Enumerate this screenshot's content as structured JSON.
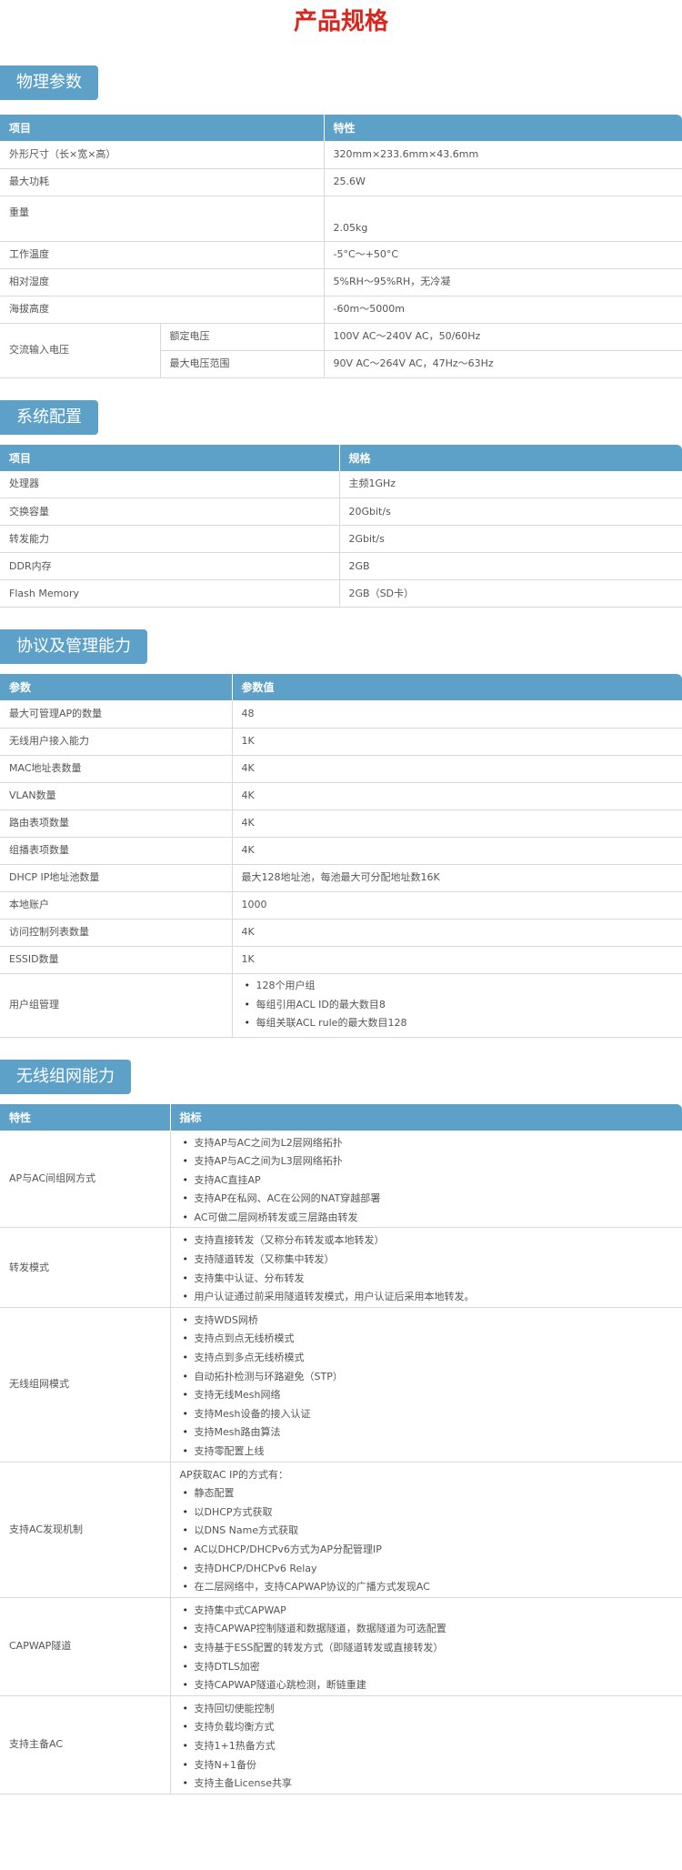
{
  "page_title": "产品规格",
  "physical": {
    "header": "物理参数",
    "col1": "项目",
    "col2": "特性",
    "rows": [
      {
        "label": "外形尺寸（长×宽×高）",
        "value": "320mm×233.6mm×43.6mm"
      },
      {
        "label": "最大功耗",
        "value": "25.6W"
      },
      {
        "label": "重量",
        "value": "2.05kg"
      },
      {
        "label": "工作温度",
        "value": "-5°C～+50°C"
      },
      {
        "label": "相对湿度",
        "value": "5%RH～95%RH，无冷凝"
      },
      {
        "label": "海拔高度",
        "value": "-60m～5000m"
      }
    ],
    "ac": {
      "label": "交流输入电压",
      "rated_label": "额定电压",
      "rated_value": "100V AC～240V AC，50/60Hz",
      "max_label": "最大电压范围",
      "max_value": "90V AC～264V AC，47Hz～63Hz"
    }
  },
  "system": {
    "header": "系统配置",
    "col1": "项目",
    "col2": "规格",
    "rows": [
      {
        "label": "处理器",
        "value": "主频1GHz"
      },
      {
        "label": "交换容量",
        "value": "20Gbit/s"
      },
      {
        "label": "转发能力",
        "value": "2Gbit/s"
      },
      {
        "label": "DDR内存",
        "value": "2GB"
      },
      {
        "label": "Flash Memory",
        "value": "2GB（SD卡）"
      }
    ]
  },
  "protocol": {
    "header": "协议及管理能力",
    "col1": "参数",
    "col2": "参数值",
    "rows": [
      {
        "label": "最大可管理AP的数量",
        "value": "48"
      },
      {
        "label": "无线用户接入能力",
        "value": "1K"
      },
      {
        "label": "MAC地址表数量",
        "value": "4K"
      },
      {
        "label": "VLAN数量",
        "value": "4K"
      },
      {
        "label": "路由表项数量",
        "value": "4K"
      },
      {
        "label": "组播表项数量",
        "value": "4K"
      },
      {
        "label": "DHCP IP地址池数量",
        "value": "最大128地址池，每池最大可分配地址数16K"
      },
      {
        "label": "本地账户",
        "value": "1000"
      },
      {
        "label": "访问控制列表数量",
        "value": "4K"
      },
      {
        "label": "ESSID数量",
        "value": "1K"
      }
    ],
    "usergroup_label": "用户组管理",
    "usergroup_items": [
      "128个用户组",
      "每组引用ACL ID的最大数目8",
      "每组关联ACL rule的最大数目128"
    ]
  },
  "wireless": {
    "header": "无线组网能力",
    "col1": "特性",
    "col2": "指标",
    "rows": [
      {
        "label": "AP与AC间组网方式",
        "items": [
          "支持AP与AC之间为L2层网络拓扑",
          "支持AP与AC之间为L3层网络拓扑",
          "支持AC直挂AP",
          "支持AP在私网、AC在公网的NAT穿越部署",
          "AC可做二层网桥转发或三层路由转发"
        ]
      },
      {
        "label": "转发模式",
        "items": [
          "支持直接转发（又称分布转发或本地转发）",
          "支持隧道转发（又称集中转发）",
          "支持集中认证、分布转发",
          "用户认证通过前采用隧道转发模式，用户认证后采用本地转发。"
        ]
      },
      {
        "label": "无线组网模式",
        "items": [
          "支持WDS网桥",
          "支持点到点无线桥模式",
          "支持点到多点无线桥模式",
          "自动拓扑检测与环路避免（STP）",
          "支持无线Mesh网络",
          "支持Mesh设备的接入认证",
          "支持Mesh路由算法",
          "支持零配置上线"
        ]
      },
      {
        "label": "支持AC发现机制",
        "intro": "AP获取AC IP的方式有：",
        "items": [
          "静态配置",
          "以DHCP方式获取",
          "以DNS Name方式获取",
          "AC以DHCP/DHCPv6方式为AP分配管理IP",
          "支持DHCP/DHCPv6 Relay",
          "在二层网络中，支持CAPWAP协议的广播方式发现AC"
        ]
      },
      {
        "label": "CAPWAP隧道",
        "items": [
          "支持集中式CAPWAP",
          "支持CAPWAP控制隧道和数据隧道，数据隧道为可选配置",
          "支持基于ESS配置的转发方式（即隧道转发或直接转发）",
          "支持DTLS加密",
          "支持CAPWAP隧道心跳检测，断链重建"
        ]
      },
      {
        "label": "支持主备AC",
        "items": [
          "支持回切使能控制",
          "支持负载均衡方式",
          "支持1+1热备方式",
          "支持N+1备份",
          "支持主备License共享"
        ]
      }
    ]
  }
}
